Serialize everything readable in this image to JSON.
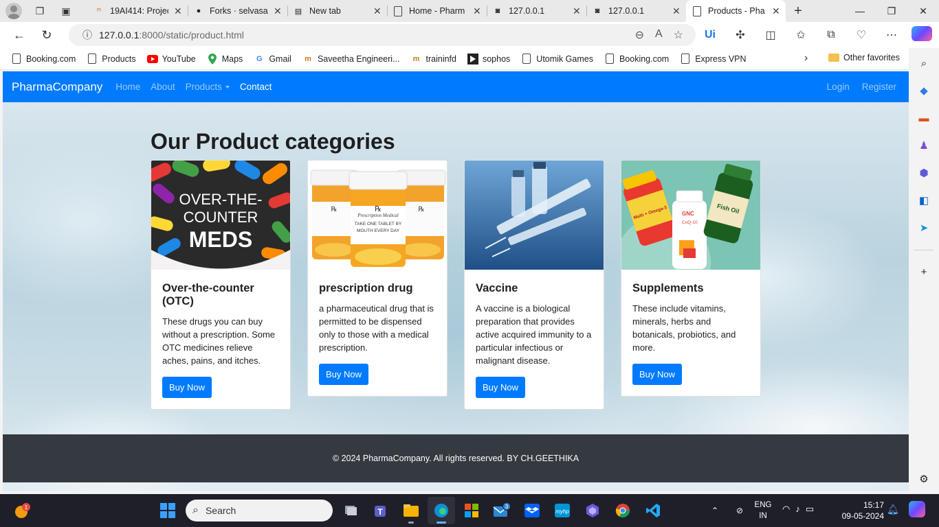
{
  "browser": {
    "tabs": [
      {
        "title": "19AI414: Projec",
        "icon": "tab-generic-icon"
      },
      {
        "title": "Forks · selvasac",
        "icon": "github-icon"
      },
      {
        "title": "New tab",
        "icon": "newtab-icon"
      },
      {
        "title": "Home - Pharm",
        "icon": "page-icon"
      },
      {
        "title": "127.0.0.1",
        "icon": "file-icon"
      },
      {
        "title": "127.0.0.1",
        "icon": "file-icon"
      },
      {
        "title": "Products - Pha",
        "icon": "page-icon",
        "active": true
      }
    ],
    "url_host": "127.0.0.1",
    "url_path": ":8000/static/product.html",
    "favorites": [
      "Booking.com",
      "Products",
      "YouTube",
      "Maps",
      "Gmail",
      "Saveetha Engineeri...",
      "traininfd",
      "sophos",
      "Utomik Games",
      "Booking.com",
      "Express VPN"
    ],
    "other_favorites": "Other favorites"
  },
  "site": {
    "brand": "PharmaCompany",
    "nav": {
      "home": "Home",
      "about": "About",
      "products": "Products",
      "contact": "Contact",
      "login": "Login",
      "register": "Register"
    },
    "heading": "Our Product categories",
    "cards": [
      {
        "title": "Over-the-counter (OTC)",
        "text": "These drugs you can buy without a prescription. Some OTC medicines relieve aches, pains, and itches.",
        "button": "Buy Now",
        "img_caption_line1": "OVER-THE-",
        "img_caption_line2": "COUNTER",
        "img_caption_line3": "MEDS"
      },
      {
        "title": "prescription drug",
        "text": "a pharmaceutical drug that is permitted to be dispensed only to those with a medical prescription.",
        "button": "Buy Now",
        "label_line1": "Prescription Medical",
        "label_line2": "TAKE ONE TABLET BY",
        "label_line3": "MOUTH EVERY DAY"
      },
      {
        "title": "Vaccine",
        "text": "A vaccine is a biological preparation that provides active acquired immunity to a particular infectious or malignant disease.",
        "button": "Buy Now"
      },
      {
        "title": "Supplements",
        "text": "These include vitamins, minerals, herbs and botanicals, probiotics, and more.",
        "button": "Buy Now",
        "bottle1": "Multi + Omega-3",
        "bottle2": "GNC",
        "bottle2b": "CoQ-10",
        "bottle3": "Fish Oil"
      }
    ],
    "footer": "© 2024 PharmaCompany. All rights reserved. BY CH.GEETHIKA"
  },
  "taskbar": {
    "search_placeholder": "Search",
    "weather_badge": "1",
    "mail_badge": "3",
    "lang_line1": "ENG",
    "lang_line2": "IN",
    "time": "15:17",
    "date": "09-05-2024"
  },
  "colors": {
    "primary": "#007bff",
    "footer": "#343a40",
    "taskbar": "#1f1f2a"
  }
}
